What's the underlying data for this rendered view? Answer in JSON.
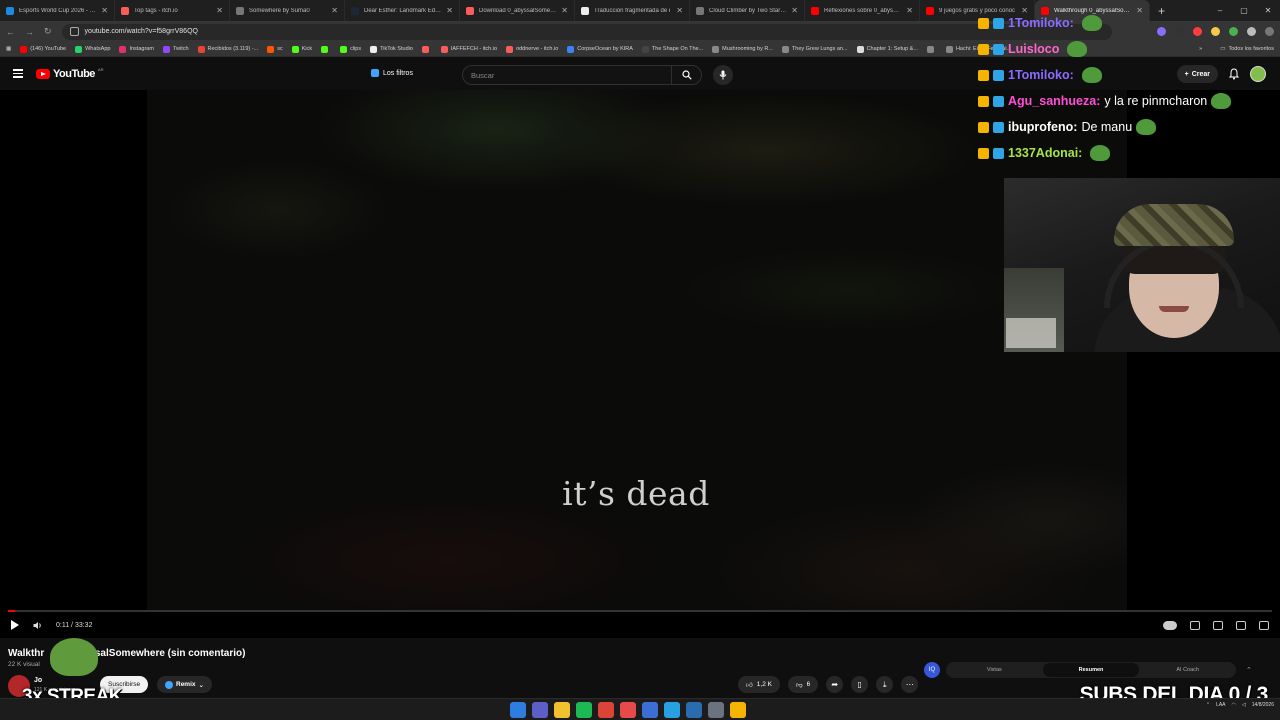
{
  "browser": {
    "tabs": [
      {
        "title": "Esports World Cup 2026 - Liq",
        "color": "#1e88e5"
      },
      {
        "title": "Top tags - itch.io",
        "color": "#fa5c5c"
      },
      {
        "title": "Somewhere by Suma0",
        "color": "#777777"
      },
      {
        "title": "Dear Esther: Landmark Editio",
        "color": "#1b2838"
      },
      {
        "title": "Download 0_abyssalSomewhe",
        "color": "#fa5c5c"
      },
      {
        "title": "Traducción fragmentada de i",
        "color": "#eeeeee"
      },
      {
        "title": "Cloud Climber by Two Star G",
        "color": "#777777"
      },
      {
        "title": "Reflexiones sobre 0_abyssalS",
        "color": "#ff0000"
      },
      {
        "title": "9 juegos gratis y poco conoc",
        "color": "#ff0000"
      },
      {
        "title": "Walkthrough 0_abyssalSomew",
        "color": "#ff0000",
        "active": true
      }
    ],
    "url": "youtube.com/watch?v=f58grrV86QQ",
    "bookmarks": [
      {
        "label": "(146) YouTube",
        "color": "#ff0000"
      },
      {
        "label": "WhatsApp",
        "color": "#25d366"
      },
      {
        "label": "Instagram",
        "color": "#e1306c"
      },
      {
        "label": "Twitch",
        "color": "#9146ff"
      },
      {
        "label": "Recibidos (3.119) -...",
        "color": "#ea4335"
      },
      {
        "label": "sc",
        "color": "#ff5500"
      },
      {
        "label": "Kick",
        "color": "#53fc18"
      },
      {
        "label": "",
        "color": "#53fc18"
      },
      {
        "label": "clips",
        "color": "#53fc18"
      },
      {
        "label": "TikTok Studio",
        "color": "#eeeeee"
      },
      {
        "label": "",
        "color": "#fa5c5c"
      },
      {
        "label": "IAFFEFCH - itch.io",
        "color": "#fa5c5c"
      },
      {
        "label": "oddnerve - itch.io",
        "color": "#fa5c5c"
      },
      {
        "label": "CorpseOcean by KIRA",
        "color": "#3b82f6"
      },
      {
        "label": "The Shape On The...",
        "color": "#444444"
      },
      {
        "label": "Mushrooming by R...",
        "color": "#888888"
      },
      {
        "label": "They Grew Lungs an...",
        "color": "#888888"
      },
      {
        "label": "Chapter 1: Setup &...",
        "color": "#dddddd"
      },
      {
        "label": "",
        "color": "#888888"
      },
      {
        "label": "Hachi: Eight Feet Tal...",
        "color": "#888888"
      }
    ],
    "bookmarks_all": "Todos los favoritos"
  },
  "youtube": {
    "logo_text": "YouTube",
    "country": "AR",
    "filters_label": "Los filtros",
    "search_placeholder": "Buscar",
    "create_label": "Crear"
  },
  "video": {
    "subtitle": "it’s dead",
    "time": "0:11 / 33:32",
    "progress_fraction": 0.0055,
    "title_left": "Walkthr",
    "title_right": "ssalSomewhere (sin comentario)",
    "views": "22 K visual",
    "views_suffix": "a",
    "channel_name": "Jo",
    "channel_subs": "121 K suscriptores",
    "subscribe_label": "Suscribirse",
    "remix_label": "Remix",
    "likes": "1,2 K",
    "dislikes": "6"
  },
  "ai_panel": {
    "icon_label": "IQ",
    "tabs": [
      "Vistas",
      "Resumen",
      "AI Coach"
    ],
    "active_tab": "Resumen"
  },
  "chat": [
    {
      "user": "1Tomiloko:",
      "message": "",
      "color": "#8a6cff"
    },
    {
      "user": "Luisloco",
      "message": "",
      "color": "#ff66cc"
    },
    {
      "user": "1Tomiloko:",
      "message": "",
      "color": "#8a6cff"
    },
    {
      "user": "Agu_sanhueza:",
      "message": "y la re pinmcharon",
      "color": "#ff4fd8"
    },
    {
      "user": "ibuprofeno:",
      "message": "De manu",
      "color": "#ffffff"
    },
    {
      "user": "1337Adonai:",
      "message": "",
      "color": "#a7e34a"
    }
  ],
  "overlay": {
    "streak": "3x STREAK",
    "subs_day": "SUBS DEL DIA 0 / 3"
  },
  "taskbar": {
    "lang": "LAA",
    "time": "",
    "date": "14/8/2026"
  }
}
